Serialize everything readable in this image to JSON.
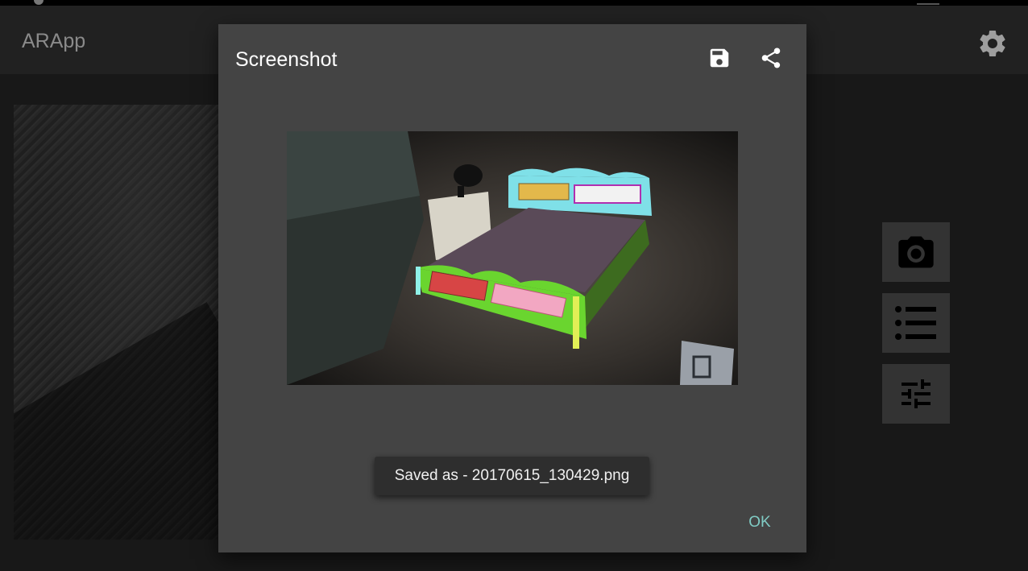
{
  "app": {
    "title": "ARApp"
  },
  "dialog": {
    "title": "Screenshot",
    "toast": "Saved as - 20170615_130429.png",
    "ok_label": "OK",
    "icons": [
      "save-icon",
      "share-icon"
    ]
  },
  "toolbar": {
    "settings_icon": "gear-icon",
    "side_buttons": [
      "camera-icon",
      "list-icon",
      "tune-icon"
    ]
  },
  "colors": {
    "accent": "#80cbc4",
    "dialog_bg": "#444444",
    "app_bar": "#212121"
  }
}
